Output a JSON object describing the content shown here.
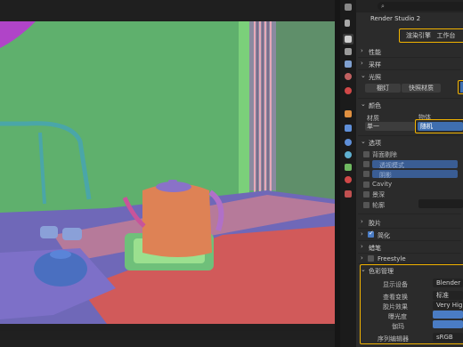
{
  "header": {
    "editor_type_icon": "properties-editor-icon",
    "search_icon": "search-icon"
  },
  "scene": {
    "title": "Render Studio 2"
  },
  "tabs": {
    "render_engine": "渲染引擎",
    "workbench": "工作台"
  },
  "panels": {
    "performance": "性能",
    "sampling": "采样",
    "lighting": "光照",
    "lighting_options": [
      "棚灯",
      "快照材质"
    ],
    "color": "颜色",
    "color_col_material": "材质",
    "color_col_object": "物体",
    "color_single": "单一",
    "color_random": "随机",
    "options": "选项",
    "backface_culling": "背面剔除",
    "xray": "透视模式",
    "shadow": "阴影",
    "cavity": "Cavity",
    "depth_of_field": "景深",
    "outline": "轮廓",
    "film": "胶片",
    "simplify": "简化",
    "grease_pencil": "蜡笔",
    "freestyle": "Freestyle",
    "color_management": "色彩管理"
  },
  "color_management": {
    "display_device_label": "显示设备",
    "display_device_value": "Blender",
    "view_transform_label": "查看变换",
    "view_transform_value": "标准",
    "look_label": "胶片效果",
    "look_value": "Very High C",
    "exposure_label": "曝光度",
    "gamma_label": "伽玛",
    "sequencer_label": "序列编辑器",
    "sequencer_value": "sRGB"
  },
  "colors": {
    "highlight": "#f2b300",
    "accent_blue": "#4a7cc4",
    "panel_bg": "#2b2b2b"
  }
}
